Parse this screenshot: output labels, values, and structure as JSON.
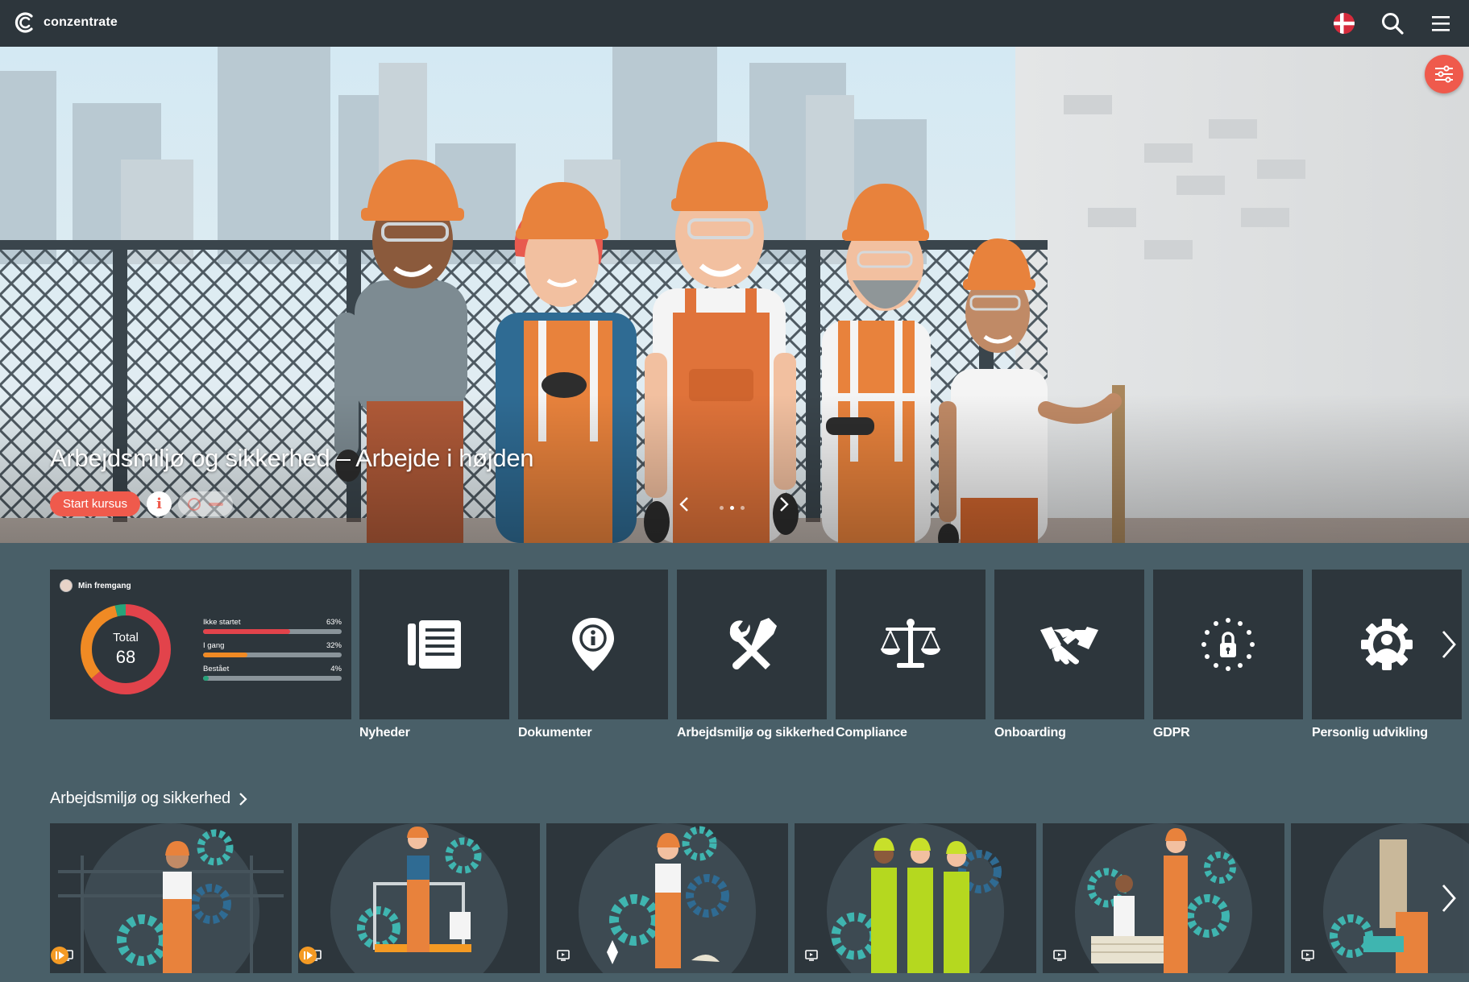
{
  "app": {
    "logo_text": "conzentrate",
    "language_flag": "danish-flag-icon"
  },
  "hero": {
    "title": "Arbejdsmiljø og sikkerhed – Arbejde i højden",
    "start_label": "Start kursus",
    "info_label": "i",
    "slide_count": 3,
    "active_slide": 1
  },
  "progress": {
    "header": "Min fremgang",
    "total_label": "Total",
    "total_value": "68",
    "items": [
      {
        "label": "Ikke startet",
        "percent": "63%",
        "value": 63,
        "color": "#e2434b"
      },
      {
        "label": "I gang",
        "percent": "32%",
        "value": 32,
        "color": "#f08a24"
      },
      {
        "label": "Bestået",
        "percent": "4%",
        "value": 4,
        "color": "#27a37a"
      }
    ]
  },
  "categories": [
    {
      "label": "Nyheder",
      "icon": "news-list-icon"
    },
    {
      "label": "Dokumenter",
      "icon": "location-info-icon"
    },
    {
      "label": "Arbejdsmiljø og sikkerhed",
      "icon": "tools-icon"
    },
    {
      "label": "Compliance",
      "icon": "scales-icon"
    },
    {
      "label": "Onboarding",
      "icon": "handshake-icon"
    },
    {
      "label": "GDPR",
      "icon": "eu-lock-icon"
    },
    {
      "label": "Personlig udvikling",
      "icon": "gear-person-icon"
    }
  ],
  "section": {
    "title": "Arbejdsmiljø og sikkerhed"
  },
  "colors": {
    "accent": "#ef5a4c",
    "topbar": "#2d363c",
    "page": "#495f68",
    "teal": "#3fb5b0",
    "orange": "#e8823c"
  }
}
